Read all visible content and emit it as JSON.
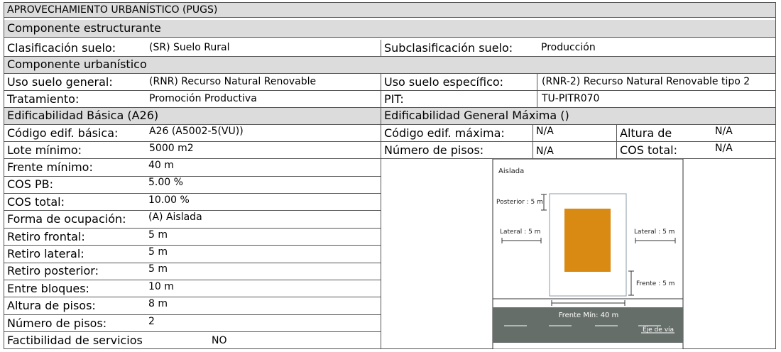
{
  "title": "APROVECHAMIENTO URBANÍSTICO (PUGS)",
  "componente_estructurante": {
    "header": "Componente  estructurante",
    "clasificacion_label": "Clasificación suelo:",
    "clasificacion_value": "(SR) Suelo Rural",
    "subclasificacion_label": "Subclasificación suelo:",
    "subclasificacion_value": "Producción"
  },
  "componente_urbanistico": {
    "header": "Componente  urbanístico",
    "uso_general_label": "Uso suelo general:",
    "uso_general_value": "(RNR) Recurso Natural Renovable",
    "uso_especifico_label": "Uso suelo específico:",
    "uso_especifico_value": "(RNR-2) Recurso Natural Renovable tipo 2",
    "tratamiento_label": "Tratamiento:",
    "tratamiento_value": "Promoción Productiva",
    "pit_label": "PIT:",
    "pit_value": "TU-PITR070"
  },
  "edificabilidad": {
    "basica_header": "Edificabilidad Básica (A26)",
    "maxima_header": "Edificabilidad General Máxima ()",
    "codigo_basica_label": "Código edif. básica:",
    "codigo_basica_value": "A26 (A5002-5(VU))",
    "codigo_maxima_label": "Código edif. máxima:",
    "codigo_maxima_value": "N/A",
    "altura_label": "Altura de",
    "altura_value": "N/A",
    "lote_label": "Lote mínimo:",
    "lote_value": "5000 m2",
    "pisos_label": "Número de pisos:",
    "pisos_value": "N/A",
    "cos_total_label": "COS total:",
    "cos_total_value": "N/A"
  },
  "basica_rows": [
    {
      "label": "Frente mínimo:",
      "value": "40 m"
    },
    {
      "label": "COS PB:",
      "value": "5.00 %"
    },
    {
      "label": "COS total:",
      "value": "10.00 %"
    },
    {
      "label": "Forma de ocupación:",
      "value": "(A) Aislada"
    },
    {
      "label": "Retiro frontal:",
      "value": "5 m"
    },
    {
      "label": "Retiro lateral:",
      "value": "5 m"
    },
    {
      "label": "Retiro posterior:",
      "value": "5 m"
    },
    {
      "label": "Entre bloques:",
      "value": "10 m"
    },
    {
      "label": "Altura de pisos:",
      "value": "8 m"
    },
    {
      "label": "Número de pisos:",
      "value": "2"
    },
    {
      "label": "Factibilidad de servicios",
      "value": "NO"
    }
  ],
  "diagram": {
    "title": "Aislada",
    "posterior": "Posterior : 5 m",
    "lateral_left": "Lateral : 5 m",
    "lateral_right": "Lateral : 5 m",
    "frente": "Frente : 5 m",
    "frente_min": "Frente Mín: 40 m",
    "eje": "Eje de vía",
    "colors": {
      "building": "#d98a12",
      "road": "#666e6a",
      "lot_border": "#8899aa"
    }
  }
}
